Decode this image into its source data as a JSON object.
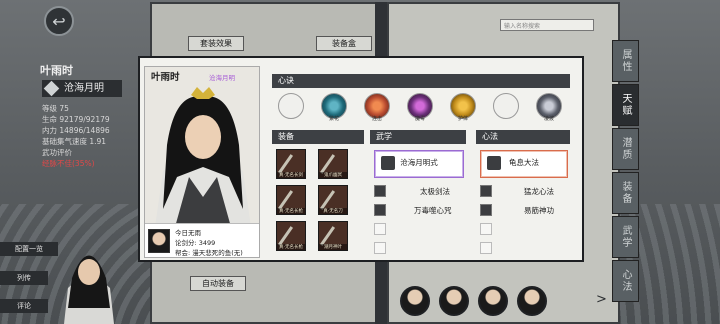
{
  "background": {
    "book_left_button": "套装效果",
    "book_mid_button": "装备盒",
    "auto_equip_button": "自动装备",
    "search_placeholder": "输入名称搜索",
    "side_tabs": [
      "属性",
      "天赋",
      "潜质",
      "装备",
      "武学",
      "心法"
    ],
    "left_panel": {
      "name": "叶雨时",
      "title": "沧海月明",
      "stats": [
        "等级 75",
        "生命 92179/92179",
        "内力 14896/14896",
        "基础集气速度 1.91",
        "武功评价"
      ],
      "warning": "经脉不佳(35%)"
    },
    "side_buttons": [
      "配置一览",
      "列传",
      "评论"
    ]
  },
  "overlay": {
    "name": "叶雨时",
    "title": "沧海月明",
    "xinjue_header": "心诀",
    "xinjue": [
      {
        "label": "",
        "color": "#ffffff",
        "icon": "empty-slot"
      },
      {
        "label": "繁花",
        "color": "#1e6a7a",
        "icon": "blossom-icon"
      },
      {
        "label": "连击",
        "color": "#b84a2f",
        "icon": "combo-icon"
      },
      {
        "label": "魔毒",
        "color": "#6a2f78",
        "icon": "poison-icon"
      },
      {
        "label": "护体",
        "color": "#c08b1a",
        "icon": "guard-icon"
      },
      {
        "label": "",
        "color": "#ffffff",
        "icon": "empty-slot"
      },
      {
        "label": "凌波",
        "color": "#5b5f6a",
        "icon": "wave-icon"
      }
    ],
    "equip_header": "装备",
    "equipment": [
      {
        "label": "真·无名长剑"
      },
      {
        "label": "鬼爪幽冥"
      },
      {
        "label": "真·无名长枪"
      },
      {
        "label": "真·无名刀"
      },
      {
        "label": "真·无名长枪"
      },
      {
        "label": "潮月神叶"
      }
    ],
    "wuxue_header": "武学",
    "wuxue_main": "沧海月明式",
    "wuxue_list": [
      "太极剑法",
      "万毒噬心咒"
    ],
    "xinfa_header": "心法",
    "xinfa_main": "龟息大法",
    "xinfa_list": [
      "猛龙心法",
      "易筋神功"
    ],
    "info": {
      "mood": "今日无雨",
      "power": "论剑分: 3499",
      "guild": "帮会: 漫天悲死的鱼(无)"
    }
  },
  "colors": {
    "wuxue_accent": "#9b6bd2",
    "xinfa_accent": "#d96c4c",
    "header_bar": "#3d4044",
    "warning": "#e04848"
  }
}
